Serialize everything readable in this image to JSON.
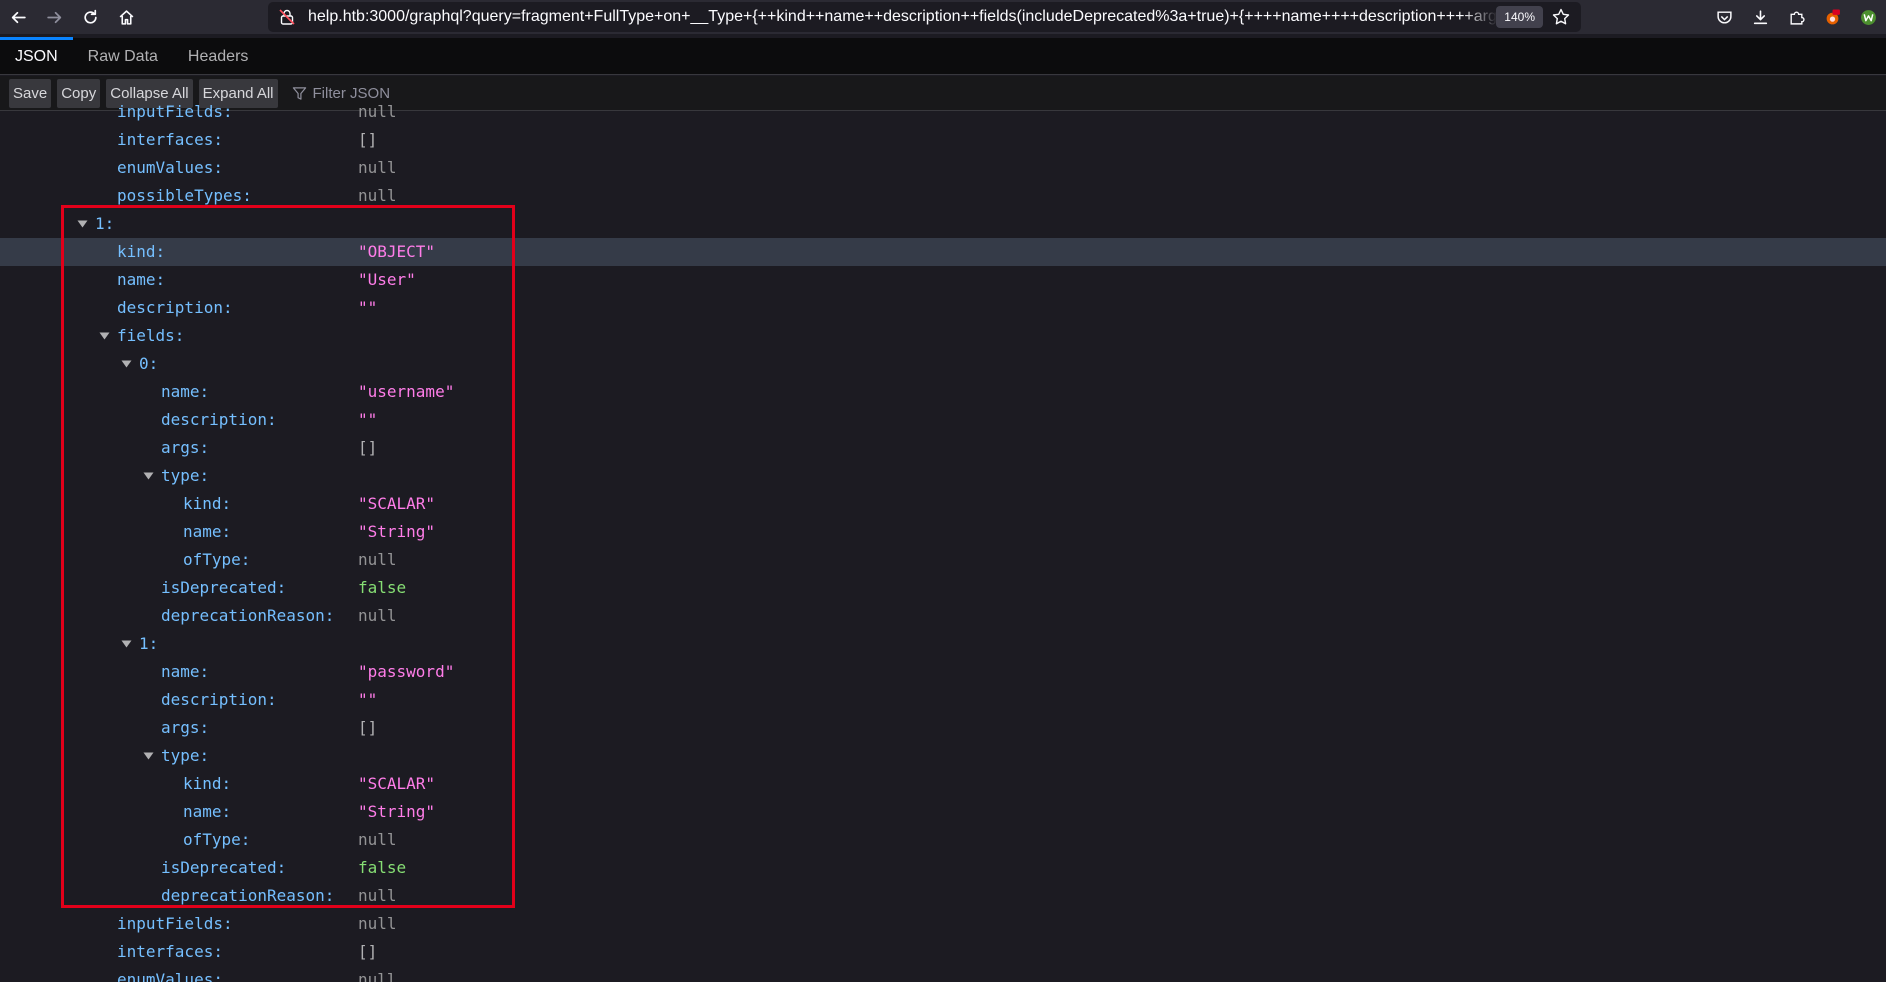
{
  "browser": {
    "url": "help.htb:3000/graphql?query=fragment+FullType+on+__Type+{++kind++name++description++fields(includeDeprecated%3a+true)+{++++name++++description++++args+{+",
    "zoom": "140%"
  },
  "viewer": {
    "tabs": [
      "JSON",
      "Raw Data",
      "Headers"
    ],
    "buttons": {
      "save": "Save",
      "copy": "Copy",
      "collapse_all": "Collapse All",
      "expand_all": "Expand All"
    },
    "filter_placeholder": "Filter JSON"
  },
  "tree_rows": [
    {
      "key": "inputFields:",
      "value": "null",
      "type": "null"
    },
    {
      "key": "interfaces:",
      "value": "[]",
      "type": "arr"
    },
    {
      "key": "enumValues:",
      "value": "null",
      "type": "null"
    },
    {
      "key": "possibleTypes:",
      "value": "null",
      "type": "null"
    },
    {
      "key": "1:",
      "value": "",
      "type": "obj",
      "expanded": true
    },
    {
      "key": "kind:",
      "value": "\"OBJECT\"",
      "type": "str",
      "highlighted": true
    },
    {
      "key": "name:",
      "value": "\"User\"",
      "type": "str"
    },
    {
      "key": "description:",
      "value": "\"\"",
      "type": "str"
    },
    {
      "key": "fields:",
      "value": "",
      "type": "obj",
      "expanded": true
    },
    {
      "key": "0:",
      "value": "",
      "type": "obj",
      "expanded": true
    },
    {
      "key": "name:",
      "value": "\"username\"",
      "type": "str"
    },
    {
      "key": "description:",
      "value": "\"\"",
      "type": "str"
    },
    {
      "key": "args:",
      "value": "[]",
      "type": "arr"
    },
    {
      "key": "type:",
      "value": "",
      "type": "obj",
      "expanded": true
    },
    {
      "key": "kind:",
      "value": "\"SCALAR\"",
      "type": "str"
    },
    {
      "key": "name:",
      "value": "\"String\"",
      "type": "str"
    },
    {
      "key": "ofType:",
      "value": "null",
      "type": "null"
    },
    {
      "key": "isDeprecated:",
      "value": "false",
      "type": "bool"
    },
    {
      "key": "deprecationReason:",
      "value": "null",
      "type": "null"
    },
    {
      "key": "1:",
      "value": "",
      "type": "obj",
      "expanded": true
    },
    {
      "key": "name:",
      "value": "\"password\"",
      "type": "str"
    },
    {
      "key": "description:",
      "value": "\"\"",
      "type": "str"
    },
    {
      "key": "args:",
      "value": "[]",
      "type": "arr"
    },
    {
      "key": "type:",
      "value": "",
      "type": "obj",
      "expanded": true
    },
    {
      "key": "kind:",
      "value": "\"SCALAR\"",
      "type": "str"
    },
    {
      "key": "name:",
      "value": "\"String\"",
      "type": "str"
    },
    {
      "key": "ofType:",
      "value": "null",
      "type": "null"
    },
    {
      "key": "isDeprecated:",
      "value": "false",
      "type": "bool"
    },
    {
      "key": "deprecationReason:",
      "value": "null",
      "type": "null"
    },
    {
      "key": "inputFields:",
      "value": "null",
      "type": "null"
    },
    {
      "key": "interfaces:",
      "value": "[]",
      "type": "arr"
    },
    {
      "key": "enumValues:",
      "value": "null",
      "type": "null"
    }
  ],
  "colors": {
    "key": "#75bfff",
    "string": "#ff7de9",
    "null": "#939395",
    "boolean": "#86de74",
    "annotation": "#e2001a"
  }
}
